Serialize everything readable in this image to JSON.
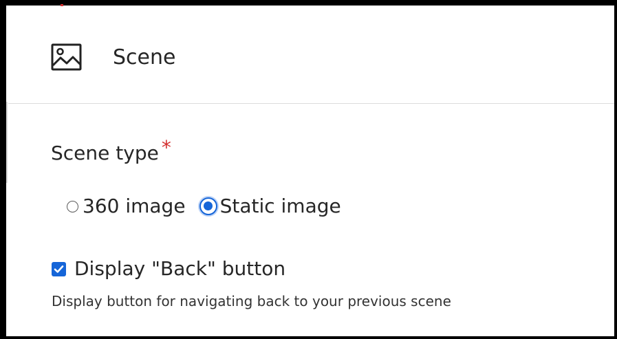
{
  "header": {
    "icon": "image-icon",
    "title": "Scene"
  },
  "scene_type": {
    "label": "Scene type",
    "required_marker": "*",
    "options": [
      {
        "label": "360 image",
        "checked": false
      },
      {
        "label": "Static image",
        "checked": true
      }
    ]
  },
  "back_button_setting": {
    "label": "Display \"Back\" button",
    "checked": true,
    "description": "Display button for navigating back to your previous scene"
  },
  "colors": {
    "accent": "#1565d8",
    "required": "#d32f2f",
    "text": "#262626"
  }
}
